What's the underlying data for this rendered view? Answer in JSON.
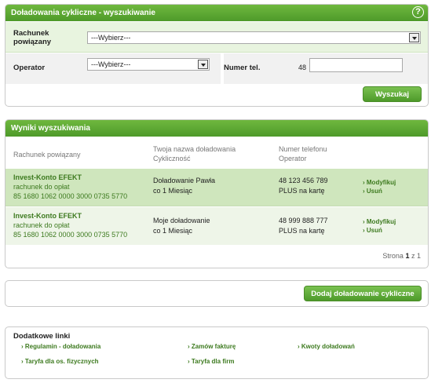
{
  "search": {
    "title": "Doładowania cykliczne - wyszukiwanie",
    "help": "?",
    "account_label_line1": "Rachunek",
    "account_label_line2": "powiązany",
    "account_value": "---Wybierz---",
    "operator_label": "Operator",
    "operator_value": "---Wybierz---",
    "phone_label": "Numer tel.",
    "phone_prefix": "48",
    "phone_value": "",
    "search_button": "Wyszukaj"
  },
  "results": {
    "title": "Wyniki wyszukiwania",
    "columns": {
      "account": "Rachunek powiązany",
      "name_line1": "Twoja nazwa doładowania",
      "name_line2": "Cykliczność",
      "phone_line1": "Numer telefonu",
      "phone_line2": "Operator"
    },
    "rows": [
      {
        "account_name": "Invest-Konto EFEKT",
        "account_type": "rachunek do opłat",
        "account_number": "85 1680 1062 0000 3000 0735 5770",
        "recharge_name": "Doładowanie Pawła",
        "frequency": "co 1  Miesiąc",
        "phone": "48 123 456 789",
        "operator": "PLUS na kartę",
        "modify": "Modyfikuj",
        "delete": "Usuń"
      },
      {
        "account_name": "Invest-Konto EFEKT",
        "account_type": "rachunek do opłat",
        "account_number": "85 1680 1062 0000 3000 0735 5770",
        "recharge_name": "Moje doładowanie",
        "frequency": "co 1  Miesiąc",
        "phone": "48 999 888 777",
        "operator": "PLUS na kartę",
        "modify": "Modyfikuj",
        "delete": "Usuń"
      }
    ],
    "pager_prefix": "Strona",
    "pager_current": "1",
    "pager_sep": "z",
    "pager_total": "1"
  },
  "add": {
    "button": "Dodaj doładowanie cykliczne"
  },
  "links": {
    "title": "Dodatkowe linki",
    "items": [
      "Regulamin - doładowania",
      "Zamów fakturę",
      "Kwoty doładowań",
      "Taryfa dla os. fizycznych",
      "Taryfa dla firm"
    ]
  }
}
